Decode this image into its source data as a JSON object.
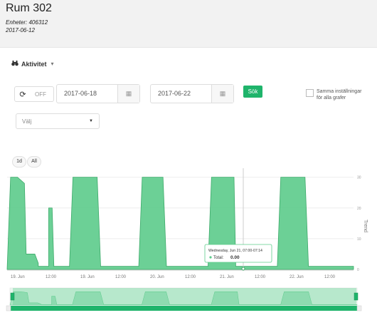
{
  "header": {
    "title": "Rum 302",
    "units": "Enheter: 406312",
    "date": "2017-06-12"
  },
  "activity_menu": {
    "label": "Aktivitet",
    "icon": "binoculars-icon"
  },
  "controls": {
    "toggle_off": "OFF",
    "start_date": "2017-06-18",
    "end_date": "2017-06-22",
    "search_label": "Sök",
    "same_settings_label": "Samma inställningar för alla grafer",
    "select_value": "Välj"
  },
  "range_buttons": [
    "1d",
    "All"
  ],
  "chart_data": {
    "type": "area",
    "color": "#5ccb8b",
    "x_tick_labels": [
      "19. Jun",
      "12:00",
      "19. Jun",
      "12:00",
      "20. Jun",
      "12:00",
      "21. Jun",
      "12:00",
      "22. Jun",
      "12:00"
    ],
    "y_axis_label": "Trend",
    "y_tick_labels": [
      "30",
      "20",
      "10",
      "0"
    ],
    "ylim": [
      0,
      32
    ],
    "series": [
      {
        "points": [
          [
            0,
            0
          ],
          [
            0.01,
            30
          ],
          [
            0.03,
            30
          ],
          [
            0.05,
            28
          ],
          [
            0.055,
            5
          ],
          [
            0.08,
            5
          ],
          [
            0.09,
            2
          ],
          [
            0.09,
            1
          ],
          [
            0.12,
            1
          ],
          [
            0.12,
            20
          ],
          [
            0.13,
            20
          ],
          [
            0.135,
            1
          ],
          [
            0.18,
            1
          ],
          [
            0.19,
            30
          ],
          [
            0.26,
            30
          ],
          [
            0.27,
            1
          ],
          [
            0.38,
            1
          ],
          [
            0.39,
            30
          ],
          [
            0.45,
            30
          ],
          [
            0.46,
            1
          ],
          [
            0.58,
            1
          ],
          [
            0.59,
            30
          ],
          [
            0.655,
            30
          ],
          [
            0.66,
            1
          ],
          [
            0.78,
            1
          ],
          [
            0.79,
            30
          ],
          [
            0.86,
            30
          ],
          [
            0.87,
            1
          ],
          [
            1.0,
            1
          ],
          [
            1.0,
            0
          ]
        ]
      }
    ],
    "tooltip": {
      "date": "Wednesday, Jun 21, 07:00-07:14",
      "label": "Total",
      "value": "0.00"
    }
  }
}
